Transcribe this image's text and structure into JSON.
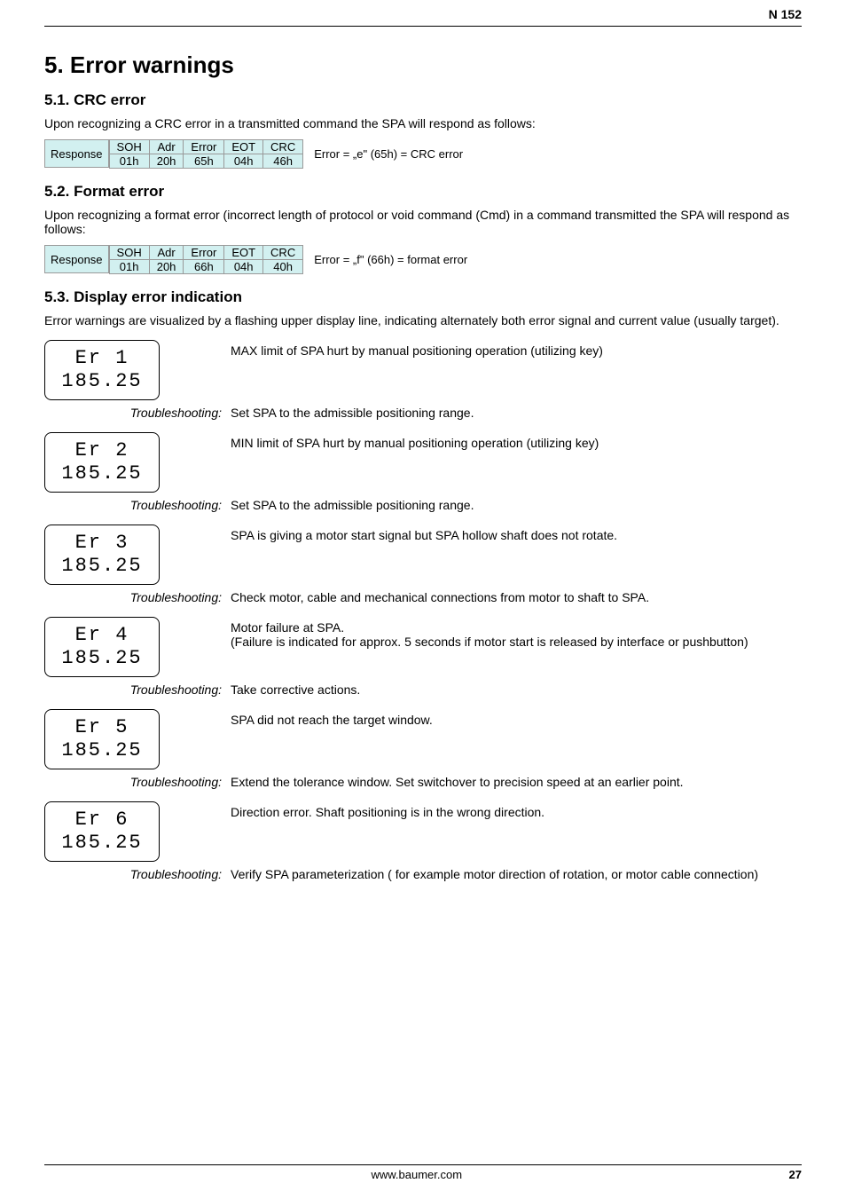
{
  "header": {
    "code": "N 152"
  },
  "h1": "5.  Error warnings",
  "sections": {
    "crc": {
      "title": "5.1.  CRC error",
      "intro": "Upon recognizing a CRC error in a transmitted command the SPA will respond as follows:",
      "resp_label": "Response",
      "cols": [
        "SOH",
        "Adr",
        "Error",
        "EOT",
        "CRC"
      ],
      "vals": [
        "01h",
        "20h",
        "65h",
        "04h",
        "46h"
      ],
      "note": "Error = „e\" (65h)  = CRC error"
    },
    "fmt": {
      "title": "5.2.  Format error",
      "intro": "Upon recognizing a format error (incorrect length of protocol or void command (Cmd) in a command transmitted the SPA will respond as follows:",
      "resp_label": "Response",
      "cols": [
        "SOH",
        "Adr",
        "Error",
        "EOT",
        "CRC"
      ],
      "vals": [
        "01h",
        "20h",
        "66h",
        "04h",
        "40h"
      ],
      "note": "Error = „f\" (66h)  = format error"
    },
    "disp": {
      "title": "5.3.  Display error indication",
      "intro": "Error warnings are visualized by a flashing upper display line, indicating alternately both error signal and current value (usually target).",
      "trouble_label": "Troubleshooting:",
      "errors": [
        {
          "seg1": "Er  1",
          "seg2": "185.25",
          "desc": "MAX limit of SPA hurt by manual positioning operation (utilizing key)",
          "fix": "Set SPA to the admissible positioning range."
        },
        {
          "seg1": "Er  2",
          "seg2": "185.25",
          "desc": "MIN limit of SPA hurt by manual positioning operation (utilizing key)",
          "fix": "Set SPA to the admissible positioning range."
        },
        {
          "seg1": "Er  3",
          "seg2": "185.25",
          "desc": "SPA is giving a motor start signal but SPA hollow shaft does not rotate.",
          "fix": "Check motor, cable and mechanical connections from motor to shaft to SPA."
        },
        {
          "seg1": "Er  4",
          "seg2": "185.25",
          "desc": "Motor failure at SPA.\n(Failure is indicated for approx. 5 seconds if motor start is released by interface or pushbutton)",
          "fix": "Take corrective actions."
        },
        {
          "seg1": "Er  5",
          "seg2": "185.25",
          "desc": "SPA did not reach the target window.",
          "fix": "Extend the tolerance window. Set switchover to precision speed at an earlier point."
        },
        {
          "seg1": "Er  6",
          "seg2": "185.25",
          "desc": "Direction error. Shaft positioning is in the wrong direction.",
          "fix": "Verify SPA parameterization ( for example motor direction of rotation, or motor cable connection)"
        }
      ]
    }
  },
  "footer": {
    "url": "www.baumer.com",
    "page": "27"
  }
}
